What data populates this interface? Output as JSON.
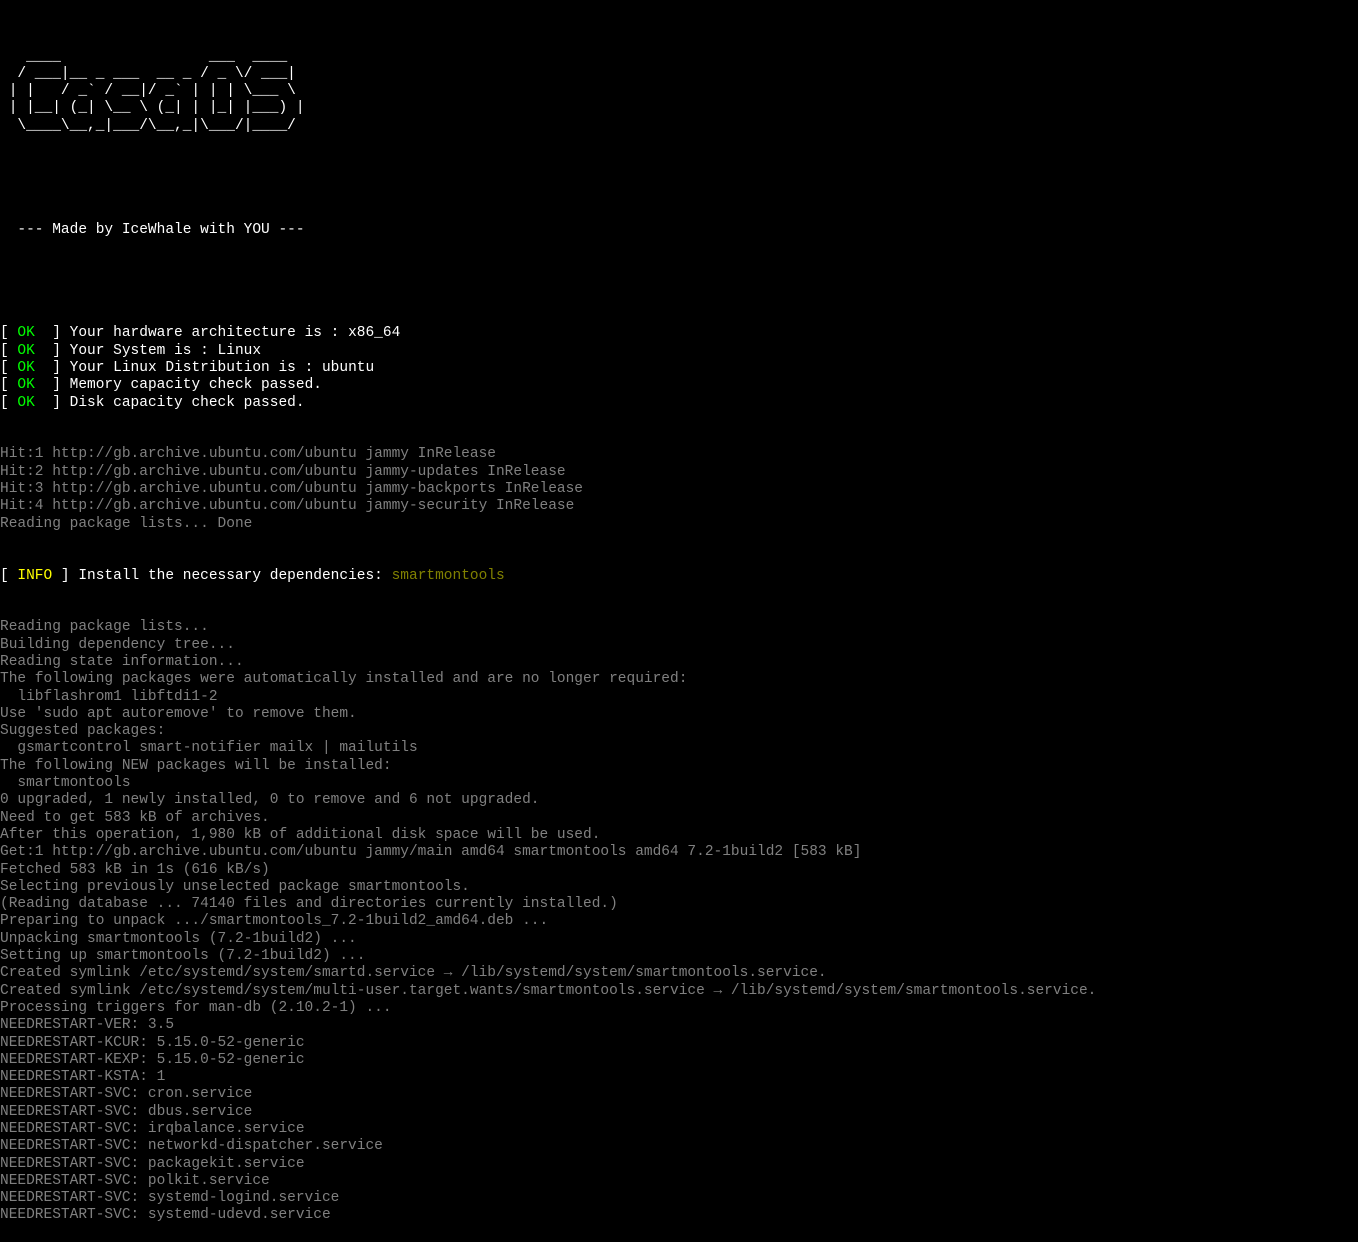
{
  "ascii_art": [
    "   ____                 ___  ____",
    "  / ___|__ _ ___  __ _ / _ \\/ ___|",
    " | |   / _` / __|/ _` | | | \\___ \\",
    " | |__| (_| \\__ \\ (_| | |_| |___) |",
    "  \\____\\__,_|___/\\__,_|\\___/|____/"
  ],
  "tagline": "  --- Made by IceWhale with YOU ---",
  "checks": [
    {
      "status": "OK",
      "msg": "Your hardware architecture is : x86_64"
    },
    {
      "status": "OK",
      "msg": "Your System is : Linux"
    },
    {
      "status": "OK",
      "msg": "Your Linux Distribution is : ubuntu"
    },
    {
      "status": "OK",
      "msg": "Memory capacity check passed."
    },
    {
      "status": "OK",
      "msg": "Disk capacity check passed."
    }
  ],
  "apt_hits": [
    "Hit:1 http://gb.archive.ubuntu.com/ubuntu jammy InRelease",
    "Hit:2 http://gb.archive.ubuntu.com/ubuntu jammy-updates InRelease",
    "Hit:3 http://gb.archive.ubuntu.com/ubuntu jammy-backports InRelease",
    "Hit:4 http://gb.archive.ubuntu.com/ubuntu jammy-security InRelease",
    "Reading package lists... Done"
  ],
  "info_line": {
    "status": "INFO",
    "msg": "Install the necessary dependencies: ",
    "dep": "smartmontools"
  },
  "apt_install": [
    "Reading package lists...",
    "Building dependency tree...",
    "Reading state information...",
    "The following packages were automatically installed and are no longer required:",
    "  libflashrom1 libftdi1-2",
    "Use 'sudo apt autoremove' to remove them.",
    "Suggested packages:",
    "  gsmartcontrol smart-notifier mailx | mailutils",
    "The following NEW packages will be installed:",
    "  smartmontools",
    "0 upgraded, 1 newly installed, 0 to remove and 6 not upgraded.",
    "Need to get 583 kB of archives.",
    "After this operation, 1,980 kB of additional disk space will be used.",
    "Get:1 http://gb.archive.ubuntu.com/ubuntu jammy/main amd64 smartmontools amd64 7.2-1build2 [583 kB]",
    "Fetched 583 kB in 1s (616 kB/s)",
    "Selecting previously unselected package smartmontools.",
    "(Reading database ... 74140 files and directories currently installed.)",
    "Preparing to unpack .../smartmontools_7.2-1build2_amd64.deb ...",
    "Unpacking smartmontools (7.2-1build2) ...",
    "Setting up smartmontools (7.2-1build2) ...",
    "Created symlink /etc/systemd/system/smartd.service → /lib/systemd/system/smartmontools.service.",
    "Created symlink /etc/systemd/system/multi-user.target.wants/smartmontools.service → /lib/systemd/system/smartmontools.service.",
    "Processing triggers for man-db (2.10.2-1) ...",
    "NEEDRESTART-VER: 3.5",
    "NEEDRESTART-KCUR: 5.15.0-52-generic",
    "NEEDRESTART-KEXP: 5.15.0-52-generic",
    "NEEDRESTART-KSTA: 1",
    "NEEDRESTART-SVC: cron.service",
    "NEEDRESTART-SVC: dbus.service",
    "NEEDRESTART-SVC: irqbalance.service",
    "NEEDRESTART-SVC: networkd-dispatcher.service",
    "NEEDRESTART-SVC: packagekit.service",
    "NEEDRESTART-SVC: polkit.service",
    "NEEDRESTART-SVC: systemd-logind.service",
    "NEEDRESTART-SVC: systemd-udevd.service"
  ],
  "bracket_open": "[ ",
  "bracket_close": " ] ",
  "bracket_close_wide": "  ] "
}
